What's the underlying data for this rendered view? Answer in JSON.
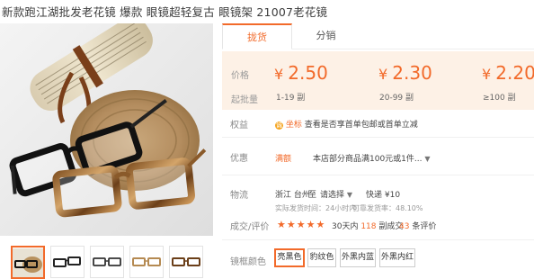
{
  "title": "新款跑江湖批发老花镜 爆款 眼镜超轻复古 眼镜架 21007老花镜",
  "tabs": [
    {
      "label": "拢货"
    },
    {
      "label": "分销"
    }
  ],
  "price": {
    "price_label": "价格",
    "qty_label": "起批量",
    "currency": "¥",
    "tiers": [
      {
        "price": "2.50",
        "qty": "1-19 副"
      },
      {
        "price": "2.30",
        "qty": "20-99 副"
      },
      {
        "price": "2.20",
        "qty": "≥100 副"
      }
    ]
  },
  "rights": {
    "label": "权益",
    "badge": "诚",
    "tag": "坐标",
    "text": "查看是否享首单包邮或首单立减"
  },
  "promo": {
    "label": "优惠",
    "tag": "满额",
    "text": "本店部分商品满100元或1件..."
  },
  "logistics": {
    "label": "物流",
    "from": "浙江 台州",
    "to_label": "至",
    "to_select": "请选择",
    "shipping": "快递 ¥10",
    "delivery": "实际发货时间：24小时内",
    "rate": "可靠发货率：48.10%"
  },
  "reviews": {
    "label": "成交/评价",
    "stars": "★★★★★",
    "sales_prefix": "30天内",
    "sales_count": "118",
    "sales_suffix": "副成交",
    "review_count": "43",
    "review_suffix": "条评价"
  },
  "color": {
    "label": "镜框颜色",
    "options": [
      "亮黑色",
      "豹纹色",
      "外黑内蓝",
      "外黑内红"
    ],
    "selected_index": 0
  },
  "colors": {
    "accent": "#f26a2a",
    "price_bg": "#fdf1e6"
  }
}
